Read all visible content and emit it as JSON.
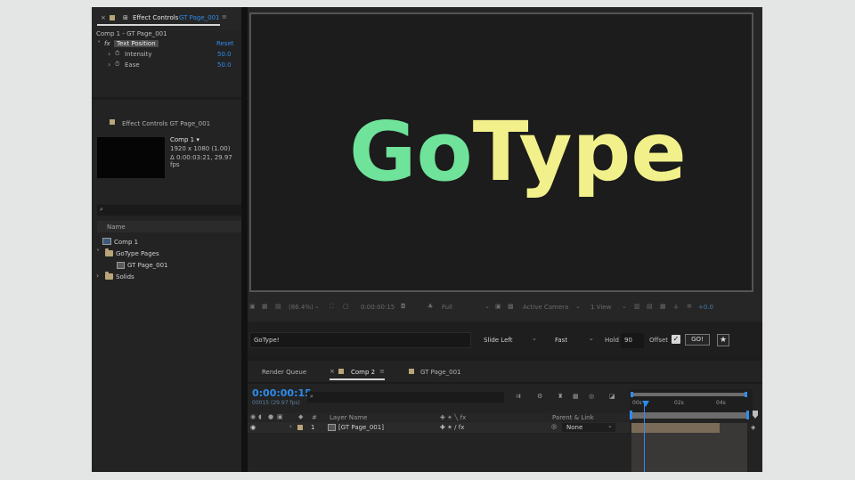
{
  "effect_controls": {
    "tab_title": "Effect Controls",
    "tab_layer": "GT Page_001",
    "comp_path": "Comp 1 - GT Page_001",
    "fx_label": "fx",
    "effect_name": "Text Position",
    "reset_label": "Reset",
    "properties": [
      {
        "name": "Intensity",
        "value": "50.0"
      },
      {
        "name": "Ease",
        "value": "50.0"
      }
    ]
  },
  "project": {
    "header_title": "Effect Controls GT Page_001",
    "preview": {
      "name": "Comp 1 ▾",
      "size": "1920 x 1080 (1.00)",
      "duration": "Δ 0:00:03:21, 29.97 fps"
    },
    "search_placeholder": "",
    "column_name": "Name",
    "items": [
      {
        "label": "Comp 1",
        "indent": 0,
        "kind": "comp"
      },
      {
        "label": "GoType Pages",
        "indent": 0,
        "kind": "folder",
        "chevron": "˅"
      },
      {
        "label": "GT Page_001",
        "indent": 1,
        "kind": "layer"
      },
      {
        "label": "Solids",
        "indent": 0,
        "kind": "folder",
        "chevron": "›"
      }
    ]
  },
  "viewer": {
    "logo_part1": "Go",
    "logo_part2": "Type",
    "logo_color1": "#6fe39a",
    "logo_color2": "#f2f08a",
    "zoom": "(86.4%)",
    "timecode": "0:00:00:15",
    "resolution": "Full",
    "camera": "Active Camera",
    "views": "1 View",
    "exposure": "+0.0"
  },
  "gotype": {
    "text_value": "GoType!",
    "animation": "Slide Left",
    "speed": "Fast",
    "hold_label": "Hold",
    "hold_value": "90",
    "offset_label": "Offset",
    "offset_checked": true,
    "go_label": "GO!",
    "star_label": "★"
  },
  "timeline": {
    "tabs": [
      {
        "label": "Render Queue",
        "active": false
      },
      {
        "label": "Comp 2",
        "active": true
      },
      {
        "label": "GT Page_001",
        "active": false
      }
    ],
    "current_time": "0:00:00:15",
    "fps_text": "00015 (29.97 fps)",
    "search_placeholder": "",
    "col_hash": "#",
    "col_layer_name": "Layer Name",
    "col_switches": "✚ ✴ ╲ fx",
    "col_parent": "Parent & Link",
    "ruler": [
      "00s",
      "02s",
      "04s"
    ],
    "layer": {
      "number": "1",
      "name": "[GT Page_001]",
      "switches": "✚ ✴ / fx",
      "parent": "None"
    }
  }
}
